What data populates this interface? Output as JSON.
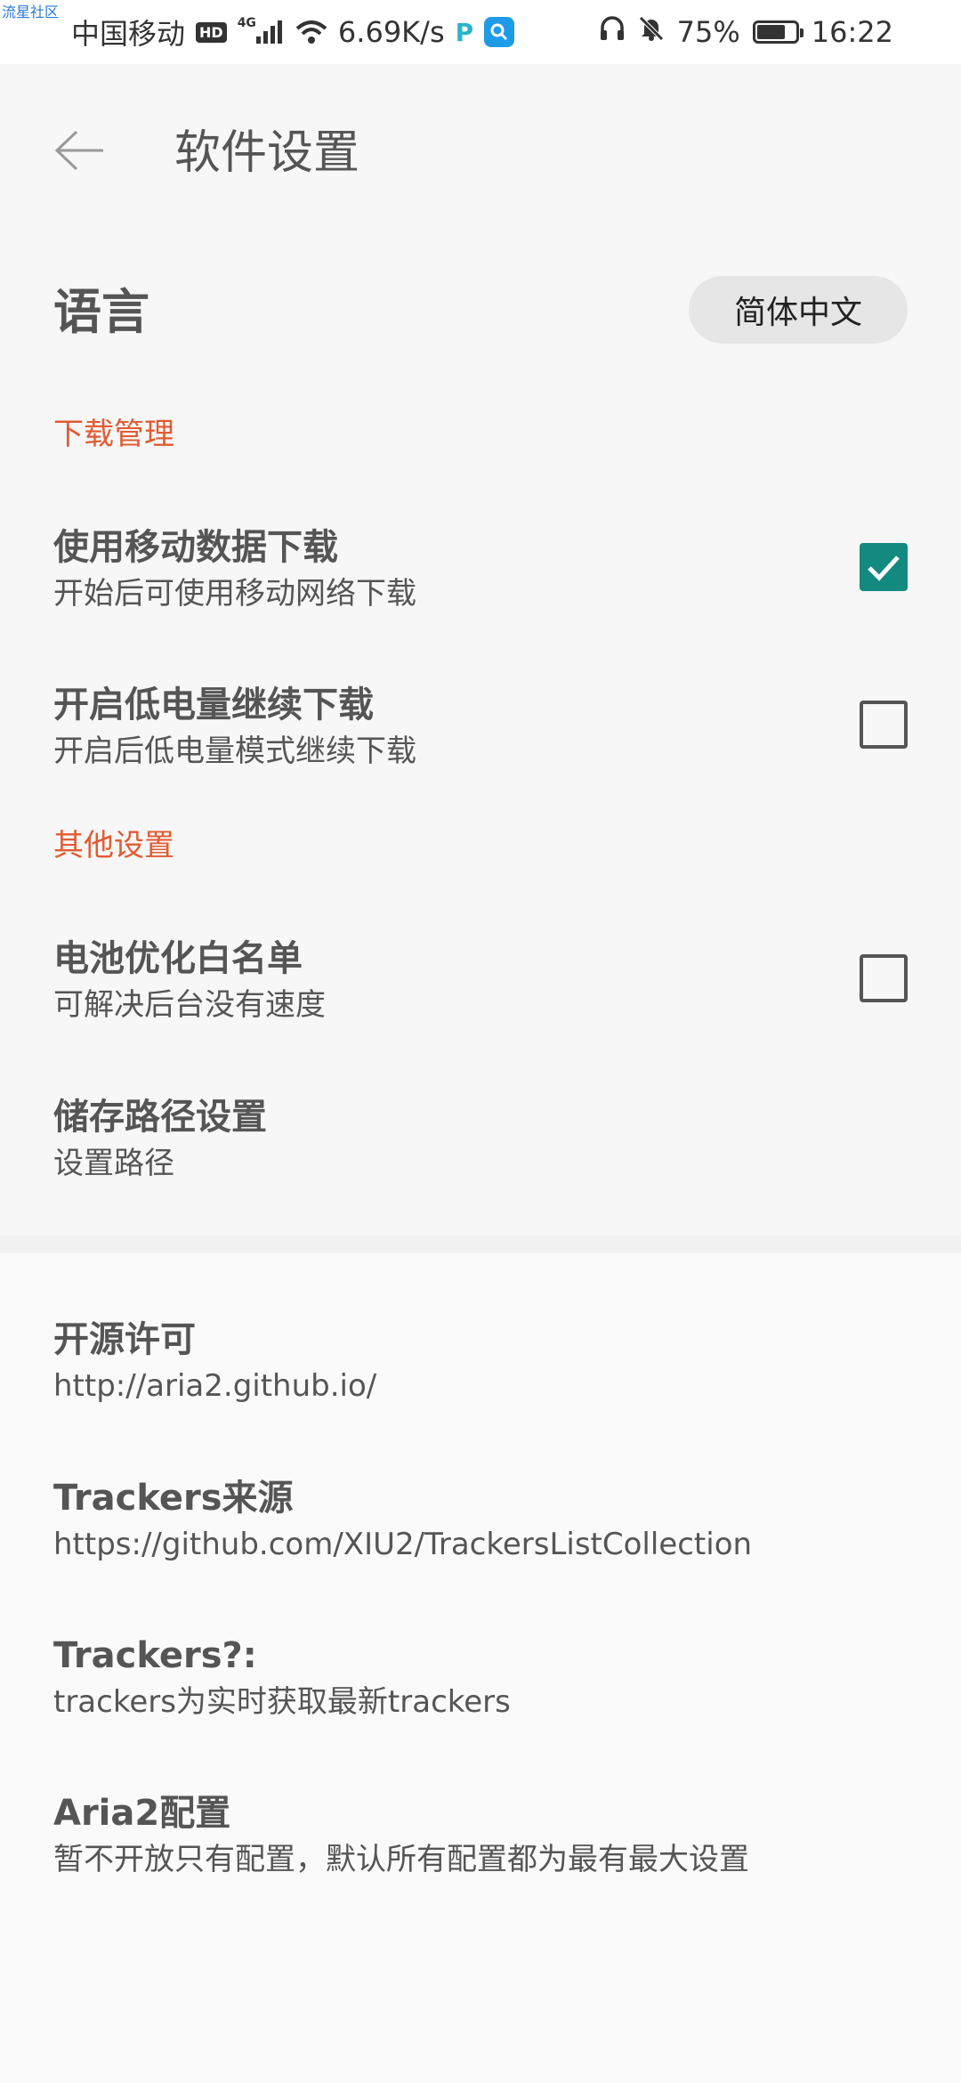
{
  "status_bar": {
    "watermark": "流星社区",
    "carrier": "中国移动",
    "hd": "HD",
    "network": "4G",
    "speed": "6.69K/s",
    "battery": "75%",
    "battery_level": 0.75,
    "time": "16:22"
  },
  "app_bar": {
    "title": "软件设置"
  },
  "language": {
    "label": "语言",
    "value": "简体中文"
  },
  "sections": {
    "download": "下载管理",
    "other": "其他设置"
  },
  "settings": {
    "mobile_data": {
      "title": "使用移动数据下载",
      "subtitle": "开始后可使用移动网络下载",
      "checked": true
    },
    "low_battery": {
      "title": "开启低电量继续下载",
      "subtitle": "开启后低电量模式继续下载",
      "checked": false
    },
    "battery_whitelist": {
      "title": "电池优化白名单",
      "subtitle": "可解决后台没有速度",
      "checked": false
    },
    "storage_path": {
      "title": "储存路径设置",
      "subtitle": "设置路径"
    }
  },
  "info": {
    "license": {
      "title": "开源许可",
      "subtitle": "http://aria2.github.io/"
    },
    "trackers_source": {
      "title": "Trackers来源",
      "subtitle": "https://github.com/XIU2/TrackersListCollection"
    },
    "trackers_q": {
      "title": "Trackers?:",
      "subtitle": "trackers为实时获取最新trackers"
    },
    "aria2_config": {
      "title": "Aria2配置",
      "subtitle": "暂不开放只有配置，默认所有配置都为最有最大设置"
    }
  },
  "colors": {
    "accent_section": "#e35a32",
    "checkbox_checked": "#128a80"
  }
}
